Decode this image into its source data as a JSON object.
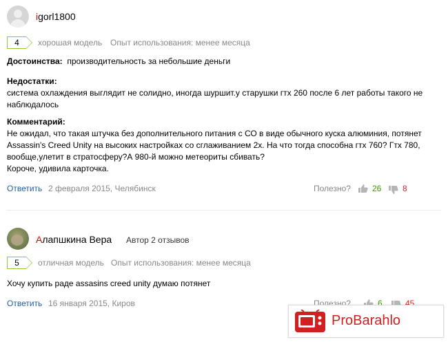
{
  "reviews": [
    {
      "author": {
        "first_letter": "i",
        "rest": "gorl1800"
      },
      "grade": "4",
      "grade_text": "хорошая модель",
      "experience": "Опыт использования: менее месяца",
      "pros_label": "Достоинства:",
      "pros_text": "производительность за небольшие деньги",
      "cons_label": "Недостатки:",
      "cons_line1": "система охлаждения выглядит не солидно, иногда шуршит.у старушки гтх 260 после 6 лет работы такого не",
      "cons_line2": "наблюдалось",
      "comment_label": "Комментарий:",
      "comment_lines": [
        "Не ожидал, что такая штучка без дополнительного питания с СО в виде обычного куска алюминия, потянет",
        "Assassin's Creed Unity на высоких настройках со сглаживанием 2х. На что тогда способна гтх 760? Гтх 780,",
        "вообще,улетит в стратосферу?А 980-й можно метеориты сбивать?",
        "Короче, удивила карточка."
      ],
      "reply_label": "Ответить",
      "date": "2 февраля 2015, Челябинск",
      "useful_label": "Полезно?",
      "up_count": "26",
      "down_count": "8"
    },
    {
      "author": {
        "first_letter": "А",
        "rest": "лапшкина Вера"
      },
      "author_meta": "Автор 2 отзывов",
      "grade": "5",
      "grade_text": "отличная модель",
      "experience": "Опыт использования: менее месяца",
      "comment_text": "Хочу купить раде assasins creed unity думаю потянет",
      "reply_label": "Ответить",
      "date": "16 января 2015, Киров",
      "useful_label": "Полезно?",
      "up_count": "6",
      "down_count": "45"
    }
  ],
  "promo": {
    "text": "ProBarahlo",
    "color": "#d21f1f"
  },
  "icons": {
    "up": "thumb-up-icon",
    "down": "thumb-down-icon"
  }
}
